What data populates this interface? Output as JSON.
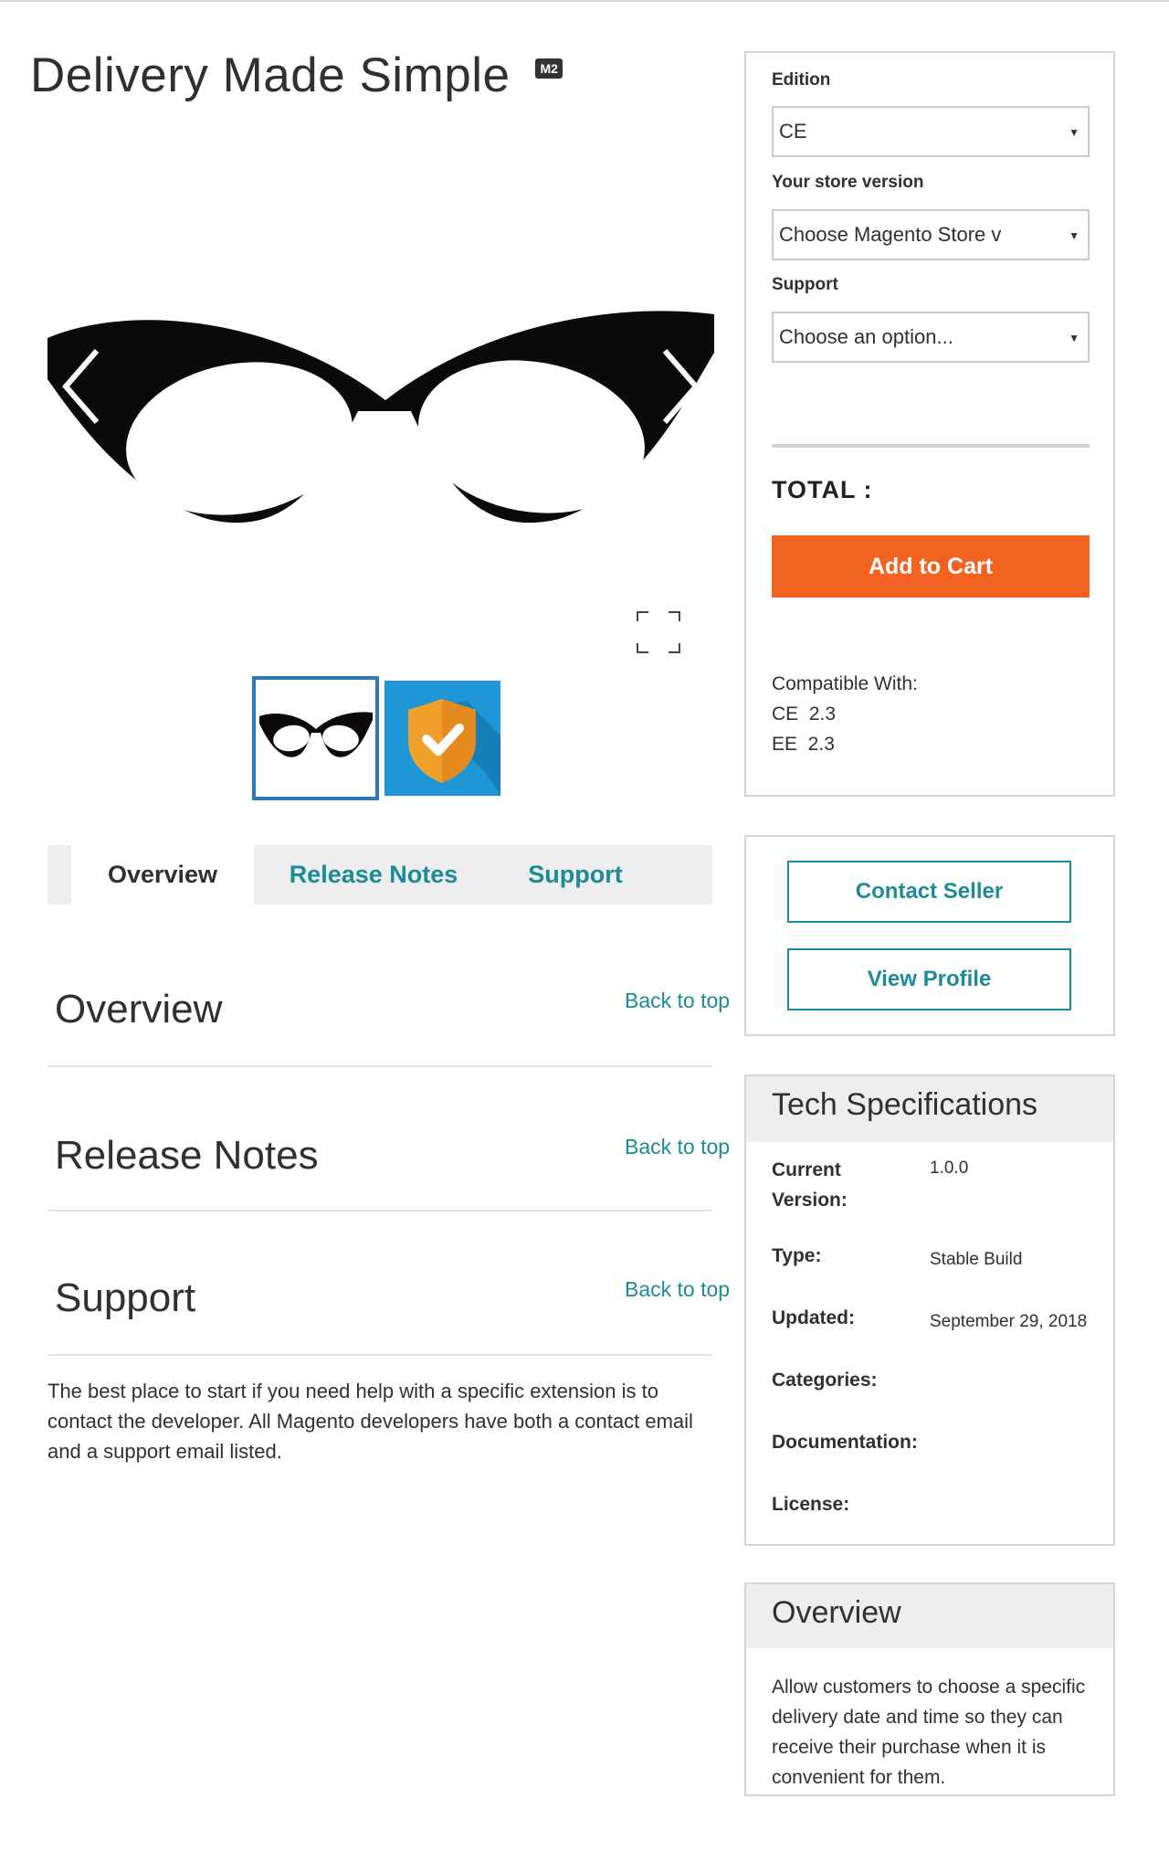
{
  "product": {
    "title": "Delivery Made Simple",
    "badge": "M2"
  },
  "gallery": {
    "prev_label": "previous",
    "next_label": "next",
    "thumbnails": [
      "cat-eye-glasses",
      "shield-check"
    ]
  },
  "tabs": [
    {
      "label": "Overview"
    },
    {
      "label": "Release Notes"
    },
    {
      "label": "Support"
    }
  ],
  "sections": {
    "overview": {
      "title": "Overview",
      "back": "Back to top"
    },
    "release": {
      "title": "Release Notes",
      "back": "Back to top"
    },
    "support": {
      "title": "Support",
      "back": "Back to top",
      "text": "The best place to start if you need help with a specific extension is to contact the developer. All Magento developers have both a contact email and a support email listed."
    }
  },
  "purchase": {
    "edition_label": "Edition",
    "edition_value": "CE",
    "store_label": "Your store version",
    "store_value": "Choose Magento Store v",
    "support_label": "Support",
    "support_value": "Choose an option...",
    "total_label": "TOTAL :",
    "add_to_cart": "Add to Cart",
    "compat_title": "Compatible With:",
    "compat": [
      "CE  2.3",
      "EE  2.3"
    ]
  },
  "seller": {
    "contact": "Contact Seller",
    "profile": "View Profile"
  },
  "tech": {
    "heading": "Tech Specifications",
    "rows": [
      {
        "label": "Current Version:",
        "value": "1.0.0"
      },
      {
        "label": "Type:",
        "value": "Stable Build"
      },
      {
        "label": "Updated:",
        "value": "September 29, 2018"
      },
      {
        "label": "Categories:",
        "value": ""
      },
      {
        "label": "Documentation:",
        "value": ""
      },
      {
        "label": "License:",
        "value": ""
      }
    ]
  },
  "overview_panel": {
    "heading": "Overview",
    "text": "Allow customers to choose a specific delivery date and time so they can receive their purchase when it is convenient for them."
  },
  "colors": {
    "accent": "#1d8b96",
    "cta": "#f26322",
    "thumb_border": "#2f7ab5"
  }
}
